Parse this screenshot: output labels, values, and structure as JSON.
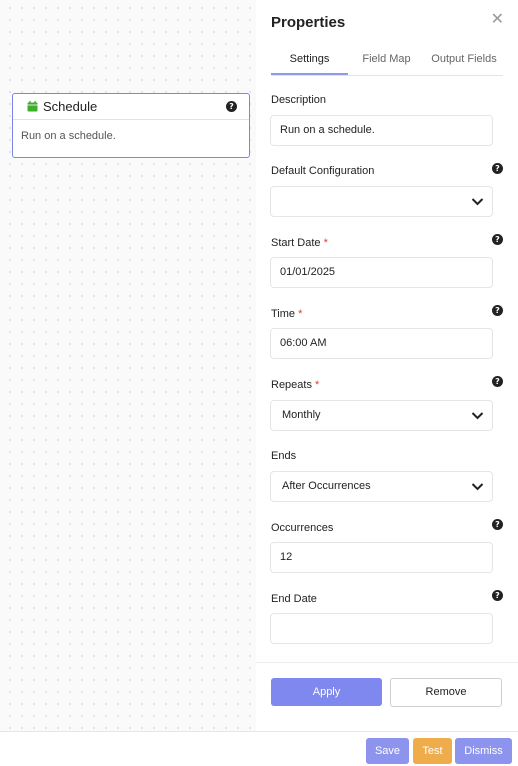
{
  "node": {
    "title": "Schedule",
    "description": "Run on a schedule.",
    "icon": "calendar-icon",
    "icon_color": "#3fae2a"
  },
  "panel": {
    "title": "Properties",
    "tabs": [
      {
        "label": "Settings",
        "active": true
      },
      {
        "label": "Field Map",
        "active": false
      },
      {
        "label": "Output Fields",
        "active": false
      }
    ],
    "fields": {
      "description": {
        "label": "Description",
        "value": "Run on a schedule."
      },
      "default_configuration": {
        "label": "Default Configuration",
        "value": ""
      },
      "start_date": {
        "label": "Start Date",
        "required_mark": "*",
        "value": "01/01/2025"
      },
      "time": {
        "label": "Time",
        "required_mark": "*",
        "value": "06:00 AM"
      },
      "repeats": {
        "label": "Repeats",
        "required_mark": "*",
        "value": "Monthly"
      },
      "ends": {
        "label": "Ends",
        "value": "After Occurrences"
      },
      "occurrences": {
        "label": "Occurrences",
        "value": "12"
      },
      "end_date": {
        "label": "End Date",
        "value": ""
      }
    },
    "apply_label": "Apply",
    "remove_label": "Remove"
  },
  "footer": {
    "save_label": "Save",
    "test_label": "Test",
    "dismiss_label": "Dismiss"
  },
  "colors": {
    "accent": "#7e88ee",
    "test": "#efac4a",
    "required": "#e23a3a"
  }
}
